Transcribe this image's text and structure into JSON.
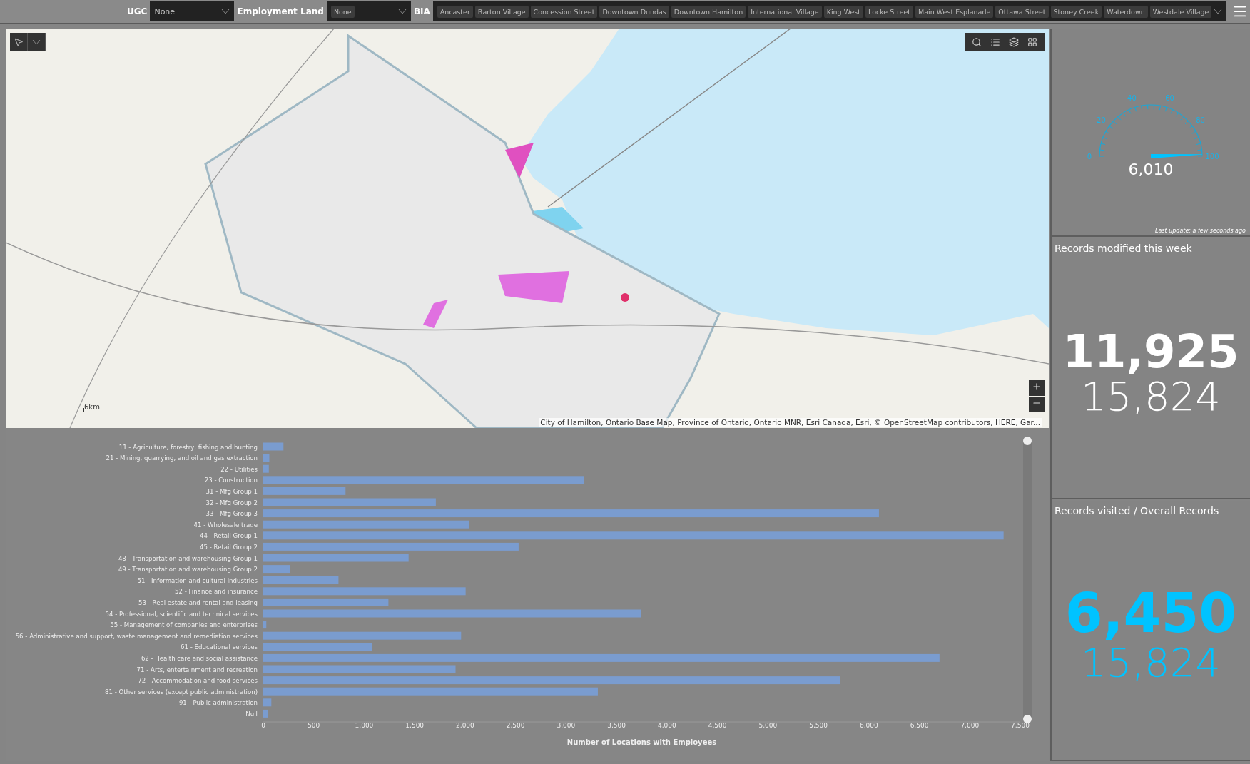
{
  "toolbar": {
    "filters": [
      {
        "label": "UGC",
        "kind": "text",
        "value": "None"
      },
      {
        "label": "Employment Land",
        "kind": "chip",
        "value": "None"
      }
    ],
    "bia": {
      "label": "BIA",
      "options": [
        "Ancaster",
        "Barton Village",
        "Concession Street",
        "Downtown Dundas",
        "Downtown Hamilton",
        "International Village",
        "King West",
        "Locke Street",
        "Main West Esplanade",
        "Ottawa Street",
        "Stoney Creek",
        "Waterdown",
        "Westdale Village"
      ]
    }
  },
  "map": {
    "attribution": "City of Hamilton, Ontario Base Map, Province of Ontario, Ontario MNR, Esri Canada, Esri, © OpenStreetMap contributors, HERE, Gar...",
    "scale": "6km"
  },
  "gauge": {
    "level": 0.99,
    "ticks": [
      "0",
      "20",
      "40",
      "60",
      "80",
      "100"
    ],
    "value": "6,010",
    "last_update": "Last update: a few seconds ago"
  },
  "stats": [
    {
      "title": "Records modified this week",
      "primary": "11,925",
      "secondary": "15,824",
      "highlight": false
    },
    {
      "title": "Records visited  / Overall Records",
      "primary": "6,450",
      "secondary": "15,824",
      "highlight": true
    }
  ],
  "chart": {
    "chart_data": {
      "type": "bar",
      "orientation": "horizontal",
      "xlabel": "Number of Locations with Employees",
      "categories": [
        "11 - Agriculture, forestry, fishing and hunting",
        "21 - Mining, quarrying, and oil and gas extraction",
        "22 - Utilities",
        "23 - Construction",
        "31 - Mfg Group 1",
        "32 - Mfg Group 2",
        "33 - Mfg Group 3",
        "41 - Wholesale trade",
        "44 - Retail Group 1",
        "45 - Retail Group 2",
        "48 - Transportation and warehousing Group 1",
        "49 - Transportation and warehousing Group 2",
        "51 - Information and cultural industries",
        "52 - Finance and insurance",
        "53 - Real estate and rental and leasing",
        "54 - Professional, scientific and technical services",
        "55 - Management of companies and enterprises",
        "56 - Administrative and support, waste management and remediation services",
        "61 - Educational services",
        "62 - Health care and social assistance",
        "71 - Arts, entertainment and recreation",
        "72 - Accommodation and food services",
        "81 - Other services (except public administration)",
        "91 - Public administration",
        "Null"
      ],
      "values": [
        200,
        60,
        55,
        3180,
        815,
        1710,
        6100,
        2040,
        7335,
        2530,
        1440,
        265,
        745,
        2005,
        1240,
        3745,
        30,
        1960,
        1075,
        6700,
        1905,
        5715,
        3315,
        80,
        45
      ],
      "xlim": [
        0,
        7500
      ],
      "xticks": [
        {
          "value": 0,
          "label": "0"
        },
        {
          "value": 500,
          "label": "500"
        },
        {
          "value": 1000,
          "label": "1,000"
        },
        {
          "value": 1500,
          "label": "1,500"
        },
        {
          "value": 2000,
          "label": "2,000"
        },
        {
          "value": 2500,
          "label": "2,500"
        },
        {
          "value": 3000,
          "label": "3,000"
        },
        {
          "value": 3500,
          "label": "3,500"
        },
        {
          "value": 4000,
          "label": "4,000"
        },
        {
          "value": 4500,
          "label": "4,500"
        },
        {
          "value": 5000,
          "label": "5,000"
        },
        {
          "value": 5500,
          "label": "5,500"
        },
        {
          "value": 6000,
          "label": "6,000"
        },
        {
          "value": 6500,
          "label": "6,500"
        },
        {
          "value": 7000,
          "label": "7,000"
        },
        {
          "value": 7500,
          "label": "7,500"
        }
      ]
    }
  }
}
